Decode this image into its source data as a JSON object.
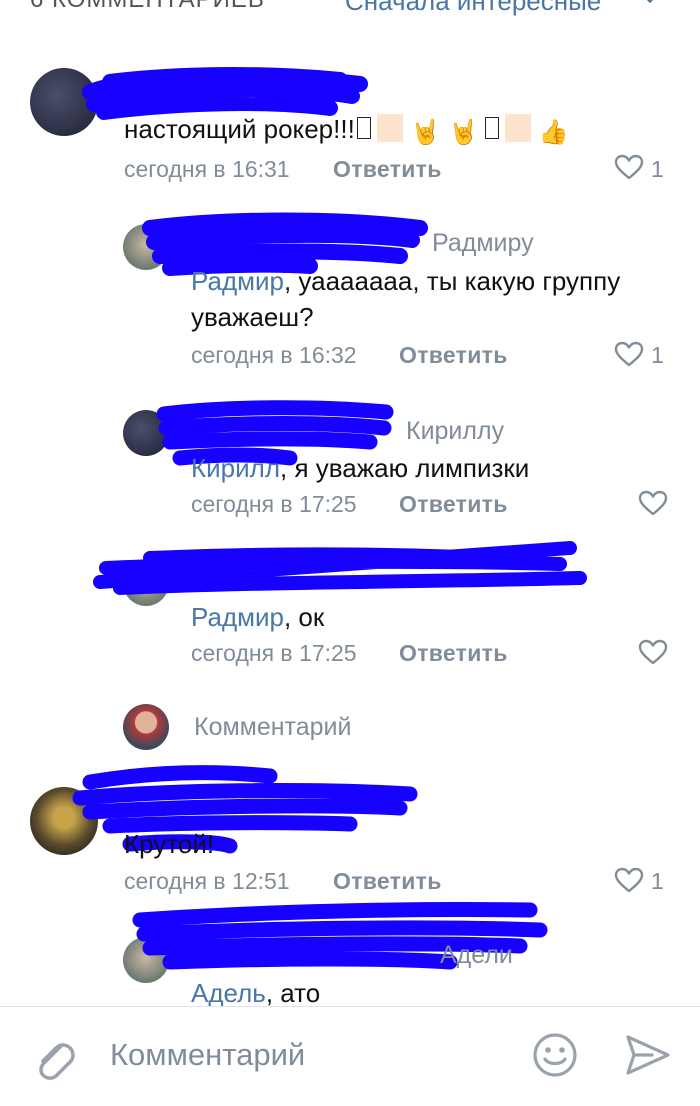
{
  "header": {
    "count_label": "6 КОММЕНТАРИЕВ",
    "sort_label": "Сначала интересные"
  },
  "comments": [
    {
      "text_parts": [
        "настоящий рокер!!!"
      ],
      "time": "сегодня в 16:31",
      "reply_label": "Ответить",
      "likes": "1"
    },
    {
      "addressee": "Радмиру",
      "mention": "Радмир",
      "text": ", уааааааа, ты какую группу",
      "text_line2": "уважаеш?",
      "time": "сегодня в 16:32",
      "reply_label": "Ответить",
      "likes": "1"
    },
    {
      "addressee": "Кириллу",
      "mention": "Кирилл",
      "text": ", я уважаю лимпизки",
      "time": "сегодня в 17:25",
      "reply_label": "Ответить",
      "likes": ""
    },
    {
      "mention": "Радмир",
      "text": ", ок",
      "time": "сегодня в 17:25",
      "reply_label": "Ответить",
      "likes": ""
    },
    {
      "text": "Крутой!",
      "time": "сегодня в 12:51",
      "reply_label": "Ответить",
      "likes": "1"
    },
    {
      "addressee": "Адели",
      "mention": "Адель",
      "text": ", ато"
    }
  ],
  "inline_reply": {
    "placeholder": "Комментарий"
  },
  "composer": {
    "placeholder": "Комментарий"
  },
  "colors": {
    "link": "#4a76a8",
    "meta": "#818c99",
    "scribble": "#1600ff"
  }
}
